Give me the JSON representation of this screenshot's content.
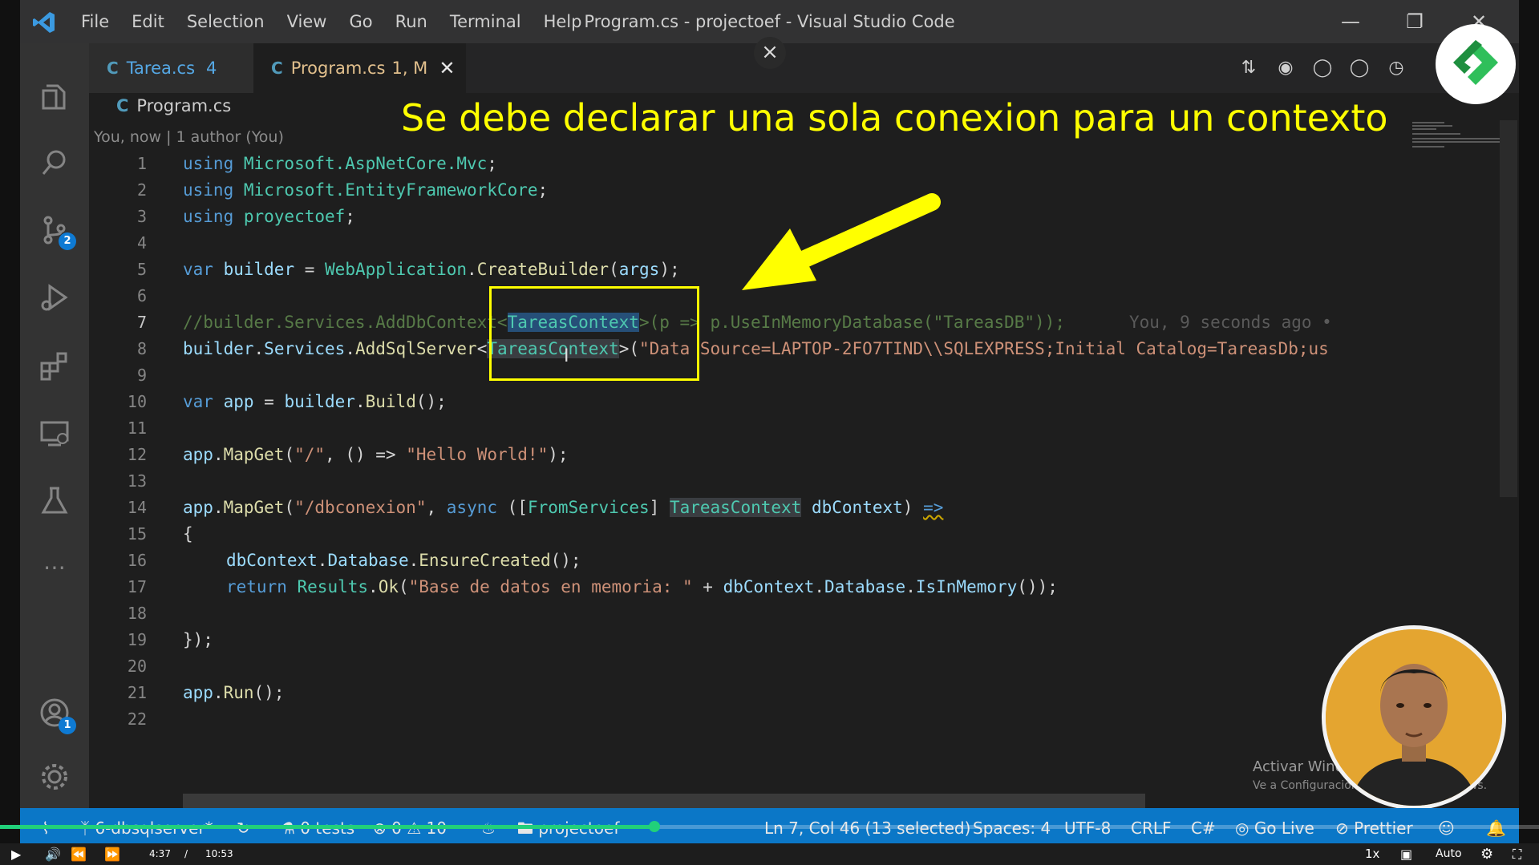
{
  "window": {
    "menu": [
      "File",
      "Edit",
      "Selection",
      "View",
      "Go",
      "Run",
      "Terminal",
      "Help"
    ],
    "title": "Program.cs - projectoef - Visual Studio Code"
  },
  "tabs": [
    {
      "name": "Tarea.cs",
      "badge": "4"
    },
    {
      "name": "Program.cs",
      "badge": "1, M"
    }
  ],
  "breadcrumb": "Program.cs",
  "blame_header": "You, now | 1 author (You)",
  "annotation": "Se debe declarar una sola conexion para un contexto",
  "activity_badges": {
    "source_control": "2",
    "accounts": "1"
  },
  "code": {
    "line_numbers": [
      "1",
      "2",
      "3",
      "4",
      "5",
      "6",
      "7",
      "8",
      "9",
      "10",
      "11",
      "12",
      "13",
      "14",
      "15",
      "16",
      "17",
      "18",
      "19",
      "20",
      "21",
      "22"
    ],
    "l1": [
      "using",
      " Microsoft.AspNetCore.Mvc",
      ";"
    ],
    "l2": [
      "using",
      " Microsoft.EntityFrameworkCore",
      ";"
    ],
    "l3": [
      "using",
      " proyectoef",
      ";"
    ],
    "l5": [
      "var",
      " builder ",
      "= ",
      "WebApplication",
      ".",
      "CreateBuilder",
      "(",
      "args",
      ");"
    ],
    "l7": [
      "//builder.Services.AddDbContext<",
      "TareasContext",
      ">(p => p.UseInMemoryDatabase(\"TareasDB\"));",
      "You, 9 seconds ago •"
    ],
    "l8": [
      "builder",
      ".",
      "Services",
      ".",
      "AddSqlServer",
      "<",
      "TareasContext",
      ">(",
      "\"Data Source=LAPTOP-2FO7TIND\\\\SQLEXPRESS;Initial Catalog=TareasDb;us"
    ],
    "l10": [
      "var",
      " app ",
      "= ",
      "builder",
      ".",
      "Build",
      "();"
    ],
    "l12": [
      "app",
      ".",
      "MapGet",
      "(",
      "\"/\"",
      ", () => ",
      "\"Hello World!\"",
      ");"
    ],
    "l14": [
      "app",
      ".",
      "MapGet",
      "(",
      "\"/dbconexion\"",
      ", ",
      "async",
      " ([",
      "FromServices",
      "] ",
      "TareasContext",
      " ",
      "dbContext",
      ") ",
      "=>"
    ],
    "l15": "{",
    "l16": [
      "dbContext",
      ".",
      "Database",
      ".",
      "EnsureCreated",
      "();"
    ],
    "l17": [
      "return",
      " ",
      "Results",
      ".",
      "Ok",
      "(",
      "\"Base de datos en memoria: \"",
      " + ",
      "dbContext",
      ".",
      "Database",
      ".",
      "IsInMemory",
      "());"
    ],
    "l19": "});",
    "l21": [
      "app",
      ".",
      "Run",
      "();"
    ]
  },
  "statusbar": {
    "branch": "6-dbsqlserver*",
    "tests": "0 tests",
    "errors": "0",
    "warnings": "10",
    "folder": "projectoef",
    "position": "Ln 7, Col 46 (13 selected)",
    "spaces": "Spaces: 4",
    "encoding": "UTF-8",
    "eol": "CRLF",
    "language": "C#",
    "golive": "Go Live",
    "prettier": "Prettier"
  },
  "watermark": {
    "line1": "Activar Windows",
    "line2": "Ve a Configuración para activar Windows."
  },
  "video": {
    "current": "4:37",
    "sep": "/",
    "duration": "10:53",
    "speed": "1x",
    "quality": "Auto",
    "progress": 0.425
  }
}
